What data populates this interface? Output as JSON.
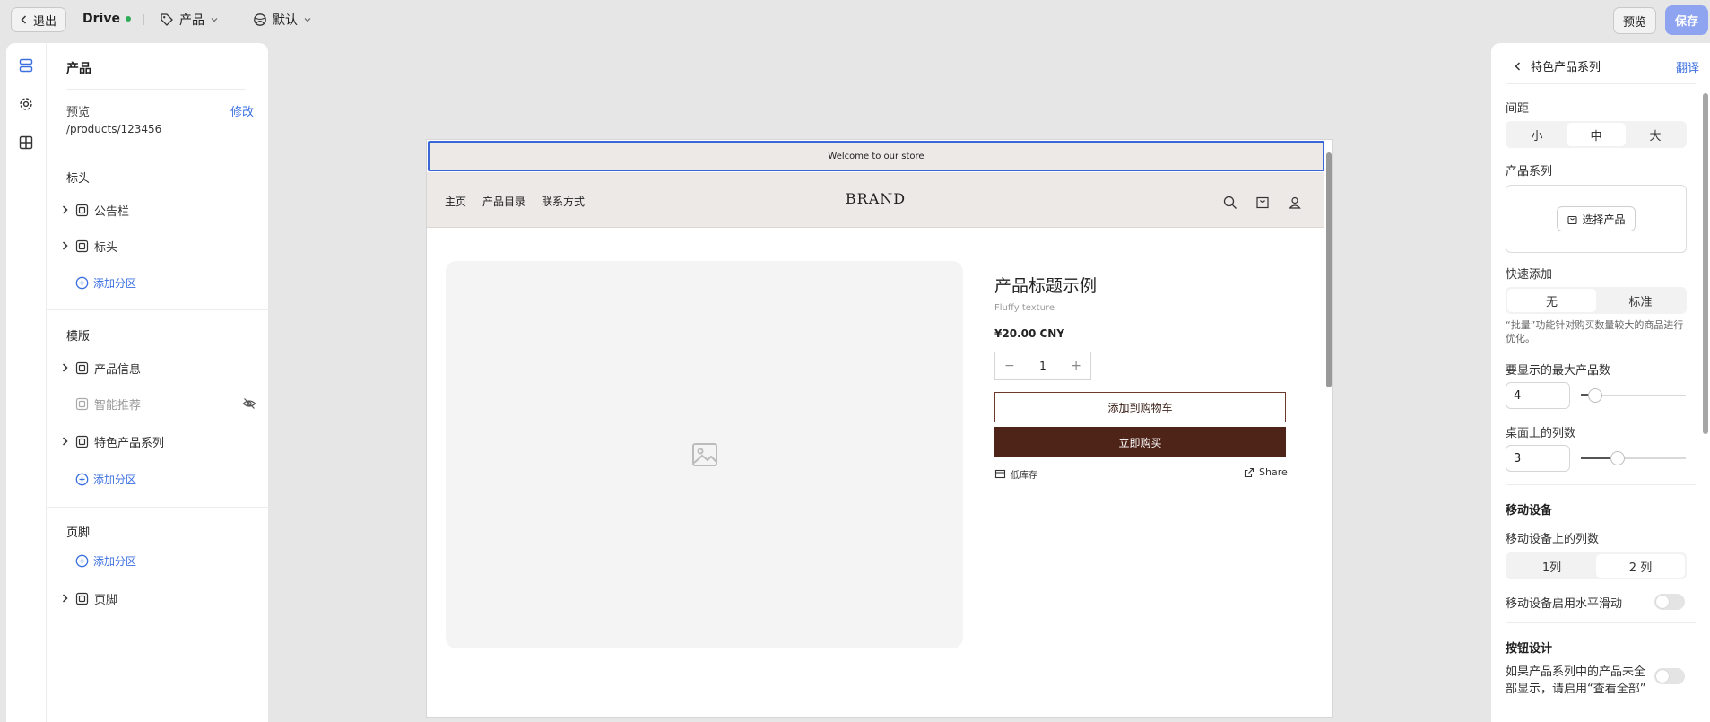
{
  "topbar": {
    "exit_label": "退出",
    "site_name": "Drive",
    "template": "产品",
    "theme": "默认",
    "preview_label": "预览",
    "save_label": "保存"
  },
  "left": {
    "title": "产品",
    "preview_label": "预览",
    "edit_label": "修改",
    "preview_path": "/products/123456",
    "groups": {
      "header_title": "标头",
      "header_items": [
        "公告栏",
        "标头"
      ],
      "template_title": "模版",
      "template_items": [
        "产品信息",
        "智能推荐",
        "特色产品系列"
      ],
      "footer_title": "页脚",
      "footer_items": [
        "页脚"
      ]
    },
    "add_section": "添加分区"
  },
  "store": {
    "announcement": "Welcome to our store",
    "nav": [
      "主页",
      "产品目录",
      "联系方式"
    ],
    "brand": "BRAND",
    "product_title": "产品标题示例",
    "product_sub": "Fluffy texture",
    "price": "¥20.00 CNY",
    "qty_minus": "−",
    "qty": "1",
    "qty_plus": "+",
    "add_to_cart": "添加到购物车",
    "buy_now": "立即购买",
    "stock": "低库存",
    "share": "Share",
    "accent_color": "#4e2318"
  },
  "right": {
    "title": "特色产品系列",
    "translate": "翻译",
    "spacing_label": "间距",
    "spacing_options": [
      "小",
      "中",
      "大"
    ],
    "spacing_selected": 1,
    "collection_label": "产品系列",
    "select_product": "选择产品",
    "quick_add_label": "快速添加",
    "quick_add_options": [
      "无",
      "标准"
    ],
    "quick_add_selected": 0,
    "quick_add_note": "“批量”功能针对购买数量较大的商品进行优化。",
    "max_products_label": "要显示的最大产品数",
    "max_products": "4",
    "max_products_level": 0.08,
    "desktop_cols_label": "桌面上的列数",
    "desktop_cols": "3",
    "desktop_cols_level": 0.33,
    "mobile_title": "移动设备",
    "mobile_cols_label": "移动设备上的列数",
    "mobile_cols_options": [
      "1列",
      "2 列"
    ],
    "mobile_cols_selected": 1,
    "mobile_scroll_label": "移动设备启用水平滑动",
    "mobile_scroll_on": false,
    "button_title": "按钮设计",
    "view_all_label": "如果产品系列中的产品未全部显示，请启用“查看全部”",
    "view_all_on": false
  },
  "colors": {
    "primary_blue": "#3b6fe0",
    "save_button": "#8fa4f0",
    "status_green": "#2eac56"
  }
}
